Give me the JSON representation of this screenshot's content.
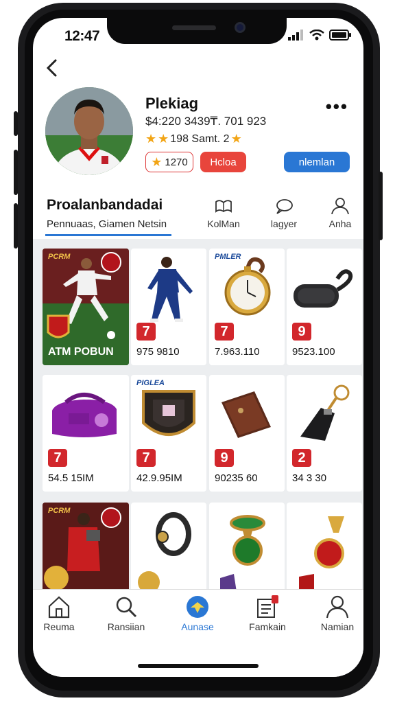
{
  "status": {
    "time": "12:47"
  },
  "profile": {
    "name": "Plekiag",
    "line": "$4:220 3439₸. 701 923",
    "rating_text": "198 Samt. 2",
    "pill_points": "1270",
    "pill_action": "Hcloa",
    "pill_primary": "nlemlan"
  },
  "section": {
    "title": "Proalanbandadai",
    "subtitle": "Pennuaas, Giamen Netsin",
    "tabs": [
      {
        "label": "KolMan",
        "icon": "book-icon"
      },
      {
        "label": "lagyer",
        "icon": "chat-icon"
      },
      {
        "label": "Anha",
        "icon": "person-icon"
      }
    ]
  },
  "grid": {
    "row1": [
      {
        "brand": "PCRM",
        "caption": "ATM POBUN",
        "type": "player-card"
      },
      {
        "badge": "7",
        "value": "975 9810",
        "type": "player"
      },
      {
        "brand": "PMLER",
        "badge": "7",
        "value": "7.963.110",
        "type": "pocket-watch"
      },
      {
        "badge": "9",
        "value": "9523.100",
        "type": "keyfob"
      }
    ],
    "row2": [
      {
        "badge": "7",
        "value": "54.5 15IM",
        "type": "bag"
      },
      {
        "brand": "PIGLEA",
        "badge": "7",
        "value": "42.9.95IM",
        "type": "crest"
      },
      {
        "badge": "9",
        "value": "90235 60",
        "type": "wallet"
      },
      {
        "badge": "2",
        "value": "34 3 30",
        "type": "keychain"
      }
    ],
    "row3": [
      {
        "brand": "PCRM",
        "type": "player-card"
      },
      {
        "type": "bracelet"
      },
      {
        "type": "trophy-green"
      },
      {
        "type": "trophy-red"
      }
    ]
  },
  "nav": [
    {
      "label": "Reuma",
      "icon": "home-icon"
    },
    {
      "label": "Ransiian",
      "icon": "search-icon"
    },
    {
      "label": "Aunase",
      "icon": "globe-icon",
      "active": true
    },
    {
      "label": "Famkain",
      "icon": "news-icon"
    },
    {
      "label": "Namian",
      "icon": "profile-icon"
    }
  ],
  "colors": {
    "accent": "#2a77d4",
    "red": "#d2272c",
    "star": "#f2a516"
  }
}
